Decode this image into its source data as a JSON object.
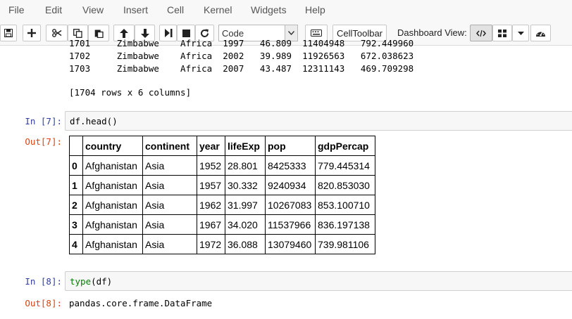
{
  "menu": [
    "File",
    "Edit",
    "View",
    "Insert",
    "Cell",
    "Kernel",
    "Widgets",
    "Help"
  ],
  "toolbar": {
    "cell_type": "Code",
    "celltoolbar_label": "CellToolbar",
    "dashboard_label": "Dashboard View:"
  },
  "prev_output": {
    "rows": [
      "1701     Zimbabwe    Africa  1997   46.809  11404948   792.449960",
      "1702     Zimbabwe    Africa  2002   39.989  11926563   672.038623",
      "1703     Zimbabwe    Africa  2007   43.487  12311143   469.709298"
    ],
    "summary": "[1704 rows x 6 columns]"
  },
  "cell7": {
    "in_prompt": "In [7]:",
    "code": "df.head()",
    "out_prompt": "Out[7]:",
    "table": {
      "columns": [
        "",
        "country",
        "continent",
        "year",
        "lifeExp",
        "pop",
        "gdpPercap"
      ],
      "rows": [
        [
          "0",
          "Afghanistan",
          "Asia",
          "1952",
          "28.801",
          "8425333",
          "779.445314"
        ],
        [
          "1",
          "Afghanistan",
          "Asia",
          "1957",
          "30.332",
          "9240934",
          "820.853030"
        ],
        [
          "2",
          "Afghanistan",
          "Asia",
          "1962",
          "31.997",
          "10267083",
          "853.100710"
        ],
        [
          "3",
          "Afghanistan",
          "Asia",
          "1967",
          "34.020",
          "11537966",
          "836.197138"
        ],
        [
          "4",
          "Afghanistan",
          "Asia",
          "1972",
          "36.088",
          "13079460",
          "739.981106"
        ]
      ]
    }
  },
  "cell8": {
    "in_prompt": "In [8]:",
    "code_func": "type",
    "code_rest": "(df)",
    "out_prompt": "Out[8]:",
    "output": "pandas.core.frame.DataFrame"
  }
}
